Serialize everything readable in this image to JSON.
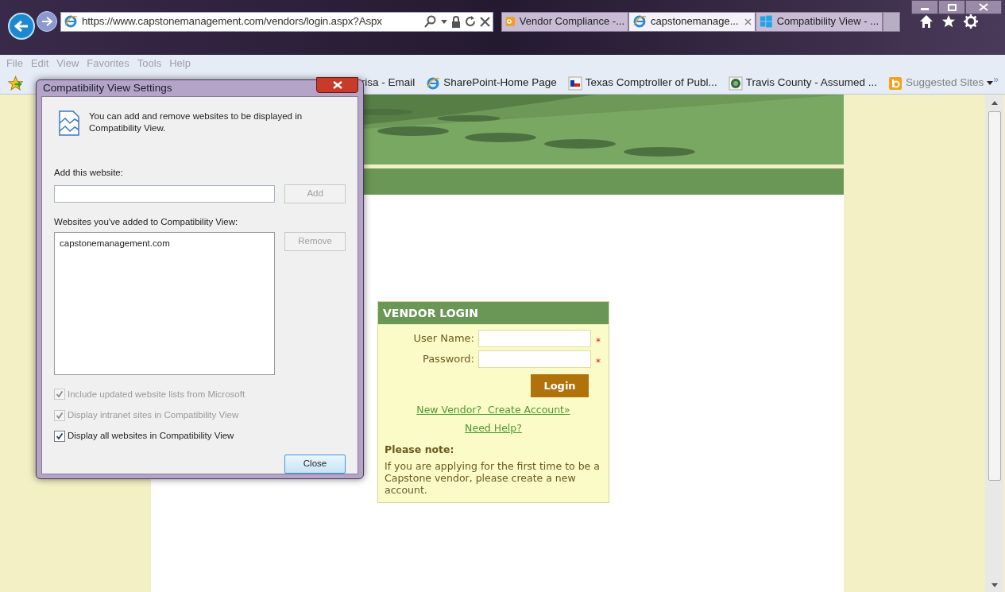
{
  "browser": {
    "address": "https://www.capstonemanagement.com/vendors/login.aspx?Aspx",
    "tabs": [
      {
        "title": "Vendor Compliance -...",
        "kind": "outlook",
        "selected": false
      },
      {
        "title": "capstonemanage...",
        "kind": "ie",
        "selected": true
      },
      {
        "title": "Compatibility View - ...",
        "kind": "windows",
        "selected": false
      }
    ],
    "menu": [
      "File",
      "Edit",
      "View",
      "Favorites",
      "Tools",
      "Help"
    ],
    "favorites": [
      {
        "label": "risa - Email",
        "kind": "none"
      },
      {
        "label": "SharePoint-Home Page",
        "kind": "ie"
      },
      {
        "label": "Texas Comptroller of Publ...",
        "kind": "flag"
      },
      {
        "label": "Travis County - Assumed ...",
        "kind": "seal"
      },
      {
        "label": "Suggested Sites",
        "kind": "suggested"
      }
    ],
    "more": "»"
  },
  "dialog": {
    "title": "Compatibility View Settings",
    "intro": "You can add and remove websites to be displayed in Compatibility View.",
    "add_label": "Add this website:",
    "add_button": "Add",
    "list_label": "Websites you've added to Compatibility View:",
    "sites": [
      "capstonemanagement.com"
    ],
    "remove_button": "Remove",
    "options": [
      {
        "label": "Include updated website lists from Microsoft",
        "checked": true,
        "disabled": true
      },
      {
        "label": "Display intranet sites in Compatibility View",
        "checked": true,
        "disabled": true
      },
      {
        "label": "Display all websites in Compatibility View",
        "checked": true,
        "disabled": false
      }
    ],
    "close_button": "Close"
  },
  "login": {
    "title": "VENDOR LOGIN",
    "required_mark": "*",
    "fields": [
      {
        "label": "User Name:",
        "required": true
      },
      {
        "label": "Password:",
        "required": true
      }
    ],
    "login_button": "Login",
    "links": [
      "New Vendor?  Create Account»",
      "Need Help?"
    ],
    "note_title": "Please note:",
    "note_text": "If you are applying for the first time to be a Capstone vendor, please create a new account."
  }
}
